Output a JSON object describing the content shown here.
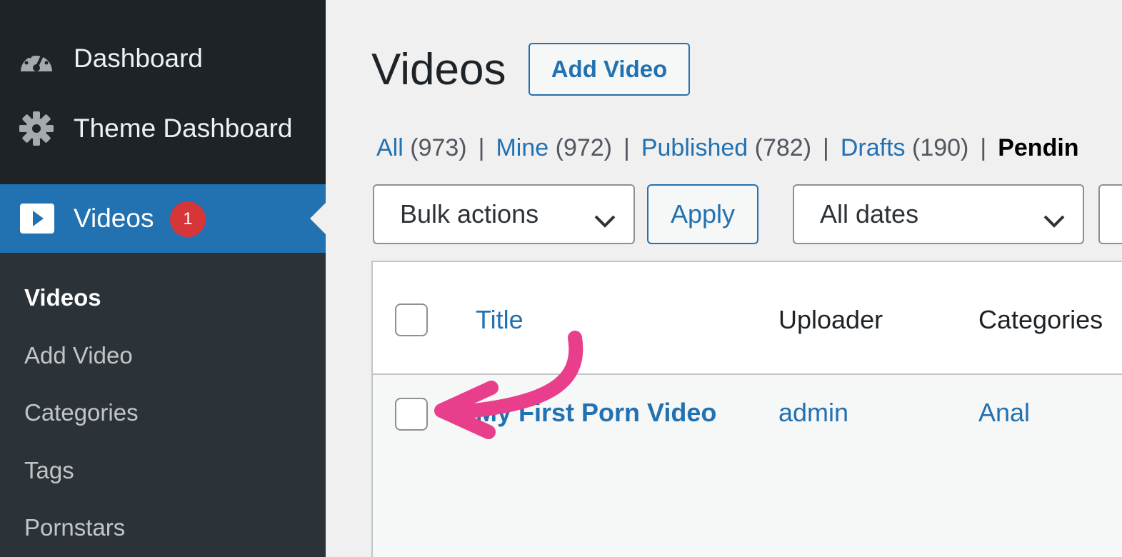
{
  "sidebar": {
    "menu": [
      {
        "label": "Dashboard",
        "icon": "dashboard-gauge-icon"
      },
      {
        "label": "Theme Dashboard",
        "icon": "gear-icon"
      }
    ],
    "active": {
      "label": "Videos",
      "icon": "video-play-icon",
      "badge": "1"
    },
    "submenu": [
      {
        "label": "Videos",
        "current": true
      },
      {
        "label": "Add Video"
      },
      {
        "label": "Categories"
      },
      {
        "label": "Tags"
      },
      {
        "label": "Pornstars"
      }
    ]
  },
  "header": {
    "title": "Videos",
    "add_button": "Add Video"
  },
  "filters": {
    "all": {
      "label": "All",
      "count": "(973)"
    },
    "mine": {
      "label": "Mine",
      "count": "(972)"
    },
    "published": {
      "label": "Published",
      "count": "(782)"
    },
    "drafts": {
      "label": "Drafts",
      "count": "(190)"
    },
    "pending": {
      "label": "Pendin"
    },
    "separator": "|"
  },
  "toolbar": {
    "bulk_actions": "Bulk actions",
    "apply": "Apply",
    "dates": "All dates"
  },
  "table": {
    "columns": {
      "title": "Title",
      "uploader": "Uploader",
      "categories": "Categories"
    },
    "rows": [
      {
        "title": "My First Porn Video",
        "uploader": "admin",
        "category": "Anal"
      }
    ]
  },
  "colors": {
    "sidebar_bg": "#1d2327",
    "submenu_bg": "#2c3338",
    "accent": "#2271b1",
    "badge": "#d63638",
    "arrow": "#e83e8c"
  }
}
